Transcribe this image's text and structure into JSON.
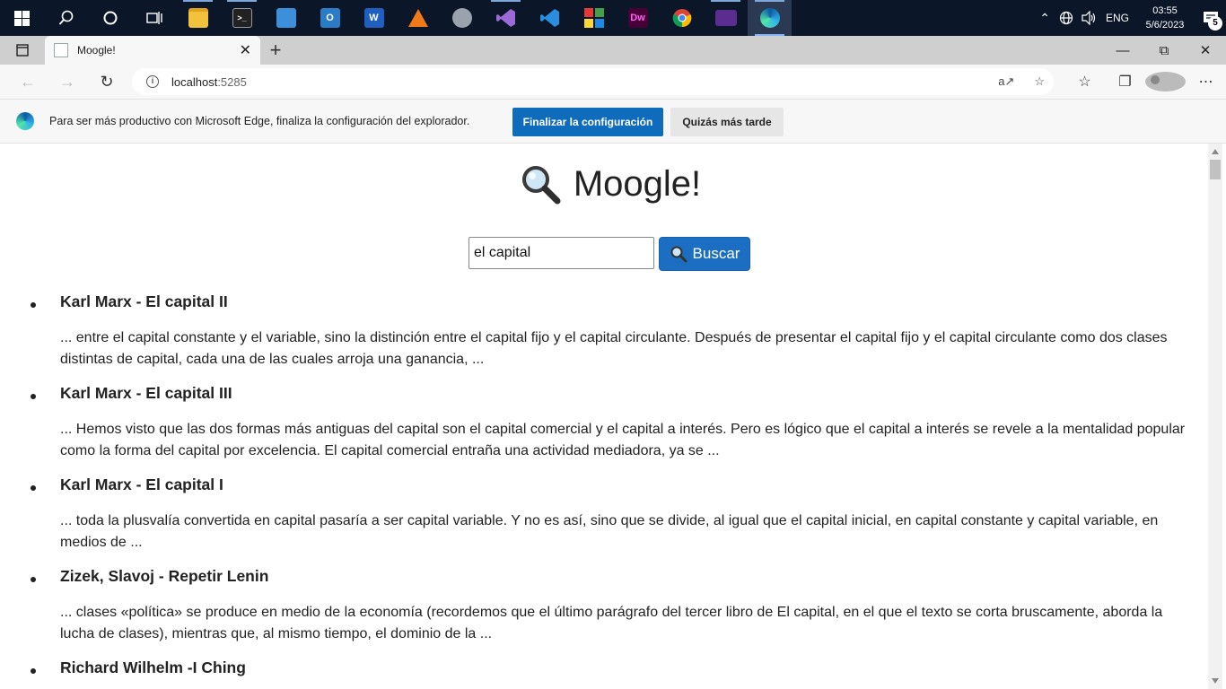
{
  "taskbar": {
    "apps": [
      {
        "name": "start",
        "icon": "windows-icon"
      },
      {
        "name": "search",
        "icon": "search-icon"
      },
      {
        "name": "cortana",
        "icon": "cortana-icon"
      },
      {
        "name": "task-view",
        "icon": "task-view-icon"
      },
      {
        "name": "file-explorer",
        "icon": "folder-icon"
      },
      {
        "name": "terminal",
        "icon": "terminal-icon"
      },
      {
        "name": "app-blue",
        "icon": "app-icon"
      },
      {
        "name": "outlook",
        "icon": "outlook-icon"
      },
      {
        "name": "word",
        "icon": "word-icon",
        "label": "W"
      },
      {
        "name": "app-orange",
        "icon": "triangle-app-icon"
      },
      {
        "name": "app-gray",
        "icon": "app-icon"
      },
      {
        "name": "visual-studio",
        "icon": "visual-studio-icon"
      },
      {
        "name": "vscode",
        "icon": "vscode-icon"
      },
      {
        "name": "app-multicolor",
        "icon": "app-icon"
      },
      {
        "name": "dreamweaver",
        "icon": "dreamweaver-icon",
        "label": "Dw"
      },
      {
        "name": "chrome",
        "icon": "chrome-icon"
      },
      {
        "name": "vs-purple",
        "icon": "app-icon"
      },
      {
        "name": "edge",
        "icon": "edge-icon"
      }
    ],
    "tray": {
      "language": "ENG",
      "time": "03:55",
      "date": "5/6/2023",
      "notifications": "5"
    }
  },
  "browser": {
    "tab_title": "Moogle!",
    "url_host": "localhost",
    "url_port": ":5285",
    "banner_message": "Para ser más productivo con Microsoft Edge, finaliza la configuración del explorador.",
    "banner_primary": "Finalizar la configuración",
    "banner_secondary": "Quizás más tarde"
  },
  "page": {
    "title": "Moogle!",
    "search_value": "el capital",
    "search_button": "Buscar",
    "results": [
      {
        "title": "Karl Marx - El capital II",
        "snippet": "... entre el capital constante y el variable, sino la distinción entre el capital fijo y el capital circulante. Después de presentar el capital fijo y el capital circulante como dos clases distintas de capital, cada una de las cuales arroja una ganancia, ..."
      },
      {
        "title": "Karl Marx - El capital III",
        "snippet": "... Hemos visto que las dos formas más antiguas del capital son el capital comercial y el capital a interés. Pero es lógico que el capital a interés se revele a la mentalidad popular como la forma del capital por excelencia. El capital comercial entraña una actividad mediadora, ya se ..."
      },
      {
        "title": "Karl Marx - El capital I",
        "snippet": "... toda la plusvalía convertida en capital pasaría a ser capital variable. Y no es así, sino que se divide, al igual que el capital inicial, en capital constante y capital variable, en medios de ..."
      },
      {
        "title": "Zizek, Slavoj - Repetir Lenin",
        "snippet": "... clases «política» se produce en medio de la economía (recordemos que el último  parágrafo del tercer libro de El capital, en el que el texto se corta bruscamente, aborda la lucha de clases), mientras que, al mismo tiempo, el dominio de la  ..."
      },
      {
        "title": "Richard Wilhelm -I Ching",
        "snippet": ""
      }
    ]
  },
  "colors": {
    "taskbar_bg": "#0b1628",
    "primary_button": "#0f6cbd",
    "search_button": "#1b6ec2"
  }
}
